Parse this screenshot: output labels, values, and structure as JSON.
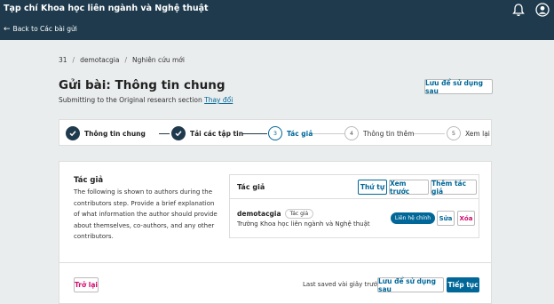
{
  "header": {
    "site_title": "Tạp chí Khoa học liên ngành và Nghệ thuật",
    "back_link": "Back to Các bài gửi"
  },
  "breadcrumb": {
    "items": [
      "31",
      "demotacgia",
      "Nghiên cứu mới"
    ],
    "separator": "/"
  },
  "page": {
    "title": "Gửi bài: Thông tin chung",
    "subtitle_prefix": "Submitting to the Original research section",
    "change_link": "Thay đổi",
    "save_for_later": "Lưu để sử dụng sau"
  },
  "steps": [
    {
      "number": "1",
      "label": "Thông tin chung",
      "state": "done"
    },
    {
      "number": "2",
      "label": "Tải các tập tin",
      "state": "done"
    },
    {
      "number": "3",
      "label": "Tác giả",
      "state": "active"
    },
    {
      "number": "4",
      "label": "Thông tin thêm",
      "state": "todo"
    },
    {
      "number": "5",
      "label": "Xem lại",
      "state": "todo"
    }
  ],
  "section": {
    "title": "Tác giả",
    "description": "The following is shown to authors during the contributors step. Provide a brief explanation of what information the author should provide about themselves, co-authors, and any other contributors."
  },
  "authors_panel": {
    "title": "Tác giả",
    "order_button": "Thứ tự",
    "preview_button": "Xem trước",
    "add_button": "Thêm tác giả",
    "author": {
      "name": "demotacgia",
      "role_tag": "Tác giả",
      "affiliation": "Trường Khoa học liên ngành và Nghệ thuật",
      "primary_contact": "Liên hệ chính",
      "edit": "Sửa",
      "delete": "Xóa"
    }
  },
  "footer": {
    "back_button": "Trở lại",
    "last_saved": "Last saved vài giây trước",
    "save_for_later": "Lưu để sử dụng sau",
    "continue_button": "Tiếp tục"
  },
  "colors": {
    "header_bg": "#1e3a4c",
    "accent": "#006798",
    "danger": "#d00a6c"
  }
}
